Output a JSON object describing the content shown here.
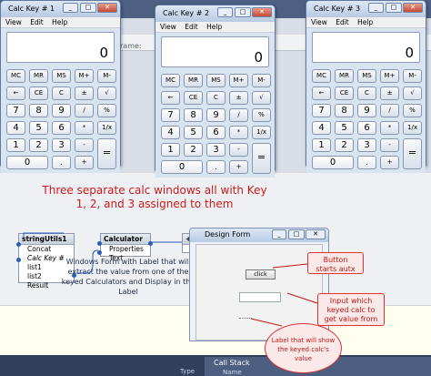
{
  "background": {
    "frame_label": "Frame:"
  },
  "calculators": [
    {
      "title": "Calc Key # 1",
      "display": "0"
    },
    {
      "title": "Calc Key # 2",
      "display": "0"
    },
    {
      "title": "Calc Key # 3",
      "display": "0"
    }
  ],
  "calc_menu": [
    "View",
    "Edit",
    "Help"
  ],
  "calc_keys": {
    "row1": [
      "MC",
      "MR",
      "MS",
      "M+",
      "M-"
    ],
    "row2": [
      "←",
      "CE",
      "C",
      "±",
      "√"
    ],
    "row3": [
      "7",
      "8",
      "9",
      "/",
      "%"
    ],
    "row4": [
      "4",
      "5",
      "6",
      "*",
      "1/x"
    ],
    "row5": [
      "1",
      "2",
      "3",
      "-",
      "="
    ],
    "row6": [
      "0",
      ".",
      "+"
    ]
  },
  "annotation_top": "Three separate calc windows all with Key 1, 2, and 3 assigned to them",
  "nodes": {
    "string_utils": {
      "title": "stringUtils1",
      "items": [
        "Concat",
        "Calc Key #",
        "list1",
        "list2",
        "Result"
      ]
    },
    "calculator": {
      "title": "Calculator",
      "items": [
        "Properties",
        "Text"
      ]
    },
    "partial": {
      "title": "+c"
    }
  },
  "annotation_middle": "Windows Form with Label that will extract the value from one of the keyed Calculators and Display in the Label",
  "design_form": {
    "title": "Design Form",
    "button_label": "click"
  },
  "callouts": {
    "button": "Button starts autx",
    "input": "Input which keyed calc to get value from",
    "label": "Label that will show the keyed calc's value"
  },
  "bottom": {
    "call_stack": "Call Stack",
    "name_col": "Name",
    "type_col": "Type"
  },
  "colors": {
    "annotation_red": "#cc1a1a",
    "connector_blue": "#2a5cb8"
  }
}
